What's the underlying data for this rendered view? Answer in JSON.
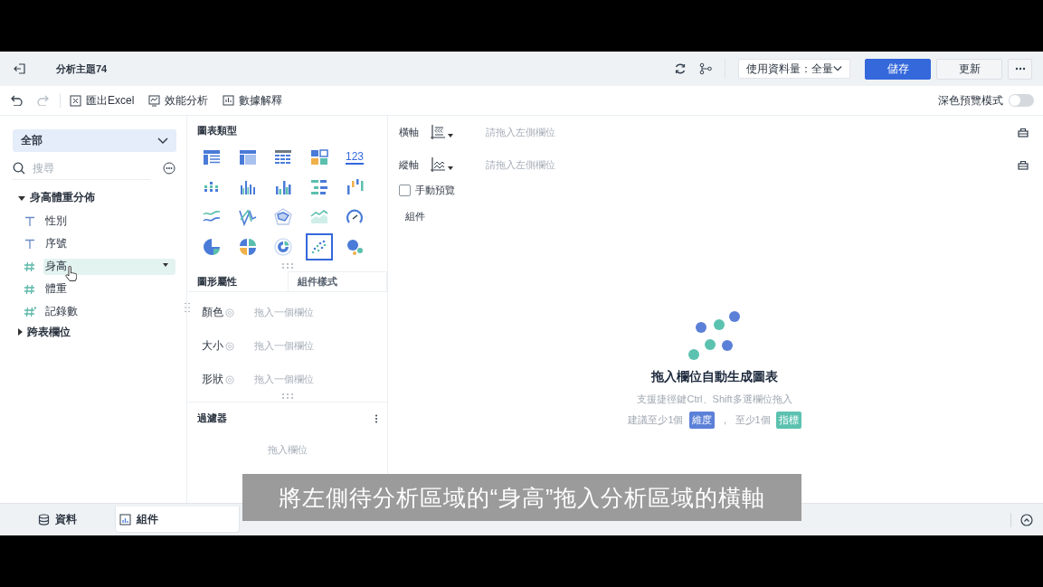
{
  "header": {
    "title": "分析主題74",
    "data_amount": "使用資料量：全量",
    "buttons": [
      {
        "label": "儲存",
        "kind": "primary"
      },
      {
        "label": "更新",
        "kind": "default"
      }
    ]
  },
  "toolbar": {
    "items": [
      {
        "label": "匯出Excel",
        "kind": "excel"
      },
      {
        "label": "效能分析",
        "kind": "perf"
      },
      {
        "label": "數據解釋",
        "kind": "explain"
      }
    ],
    "dark_preview": {
      "label": "深色預覽模式",
      "on": false
    }
  },
  "fields": {
    "scope": "全部",
    "search_placeholder": "搜尋",
    "tree": [
      {
        "label": "身高體重分佈",
        "expanded": true,
        "children": [
          {
            "label": "性別",
            "kind": "text",
            "selected": false
          },
          {
            "label": "序號",
            "kind": "text",
            "selected": false
          },
          {
            "label": "身高",
            "kind": "number",
            "selected": true
          },
          {
            "label": "體重",
            "kind": "number",
            "selected": false
          },
          {
            "label": "記錄數",
            "kind": "count",
            "selected": false
          }
        ]
      },
      {
        "label": "跨表欄位",
        "expanded": false
      }
    ]
  },
  "chart_types": {
    "title": "圖表類型",
    "items": [
      {
        "kind": "table",
        "selected": false
      },
      {
        "kind": "crosstab",
        "selected": false
      },
      {
        "kind": "detail",
        "selected": false
      },
      {
        "kind": "block",
        "selected": false
      },
      {
        "kind": "number",
        "label": "123",
        "selected": false
      },
      {
        "kind": "dotbar",
        "selected": false
      },
      {
        "kind": "bar",
        "selected": false
      },
      {
        "kind": "groupbar",
        "selected": false
      },
      {
        "kind": "rankbar",
        "selected": false
      },
      {
        "kind": "waterfall",
        "selected": false
      },
      {
        "kind": "line",
        "selected": false
      },
      {
        "kind": "crossline",
        "selected": false
      },
      {
        "kind": "radar",
        "selected": false
      },
      {
        "kind": "area",
        "selected": false
      },
      {
        "kind": "gauge",
        "selected": false
      },
      {
        "kind": "pie",
        "selected": false
      },
      {
        "kind": "multipie",
        "selected": false
      },
      {
        "kind": "ring",
        "selected": false
      },
      {
        "kind": "scatter",
        "selected": true
      },
      {
        "kind": "bubble",
        "selected": false
      }
    ]
  },
  "properties": {
    "tabs": [
      {
        "label": "圖形屬性",
        "selected": true
      },
      {
        "label": "組件樣式",
        "selected": false
      }
    ],
    "rows": [
      {
        "label": "顏色",
        "placeholder": "拖入一個欄位"
      },
      {
        "label": "大小",
        "placeholder": "拖入一個欄位"
      },
      {
        "label": "形狀",
        "placeholder": "拖入一個欄位"
      }
    ]
  },
  "filter": {
    "title": "過濾器",
    "placeholder": "拖入欄位"
  },
  "axes": [
    {
      "label": "橫軸",
      "kind": "x",
      "placeholder": "請拖入左側欄位"
    },
    {
      "label": "縱軸",
      "kind": "y",
      "placeholder": "請拖入左側欄位"
    }
  ],
  "manual_preview": {
    "label": "手動預覽",
    "checked": false
  },
  "component_label": "組件",
  "empty_state": {
    "title": "拖入欄位自動生成圖表",
    "hint": "支援捷徑鍵Ctrl、Shift多選欄位拖入",
    "suggest": [
      {
        "text": "建議至少1個"
      },
      {
        "tag": "維度",
        "color": "#5b80d8"
      },
      {
        "text": "，"
      },
      {
        "text": "至少1個"
      },
      {
        "tag": "指標",
        "color": "#5cc2b0"
      }
    ]
  },
  "bottom_tabs": [
    {
      "label": "資料",
      "kind": "data",
      "selected": false
    },
    {
      "label": "組件",
      "kind": "component",
      "selected": true
    }
  ],
  "caption": "將左側待分析區域的“身高”拖入分析區域的橫軸"
}
